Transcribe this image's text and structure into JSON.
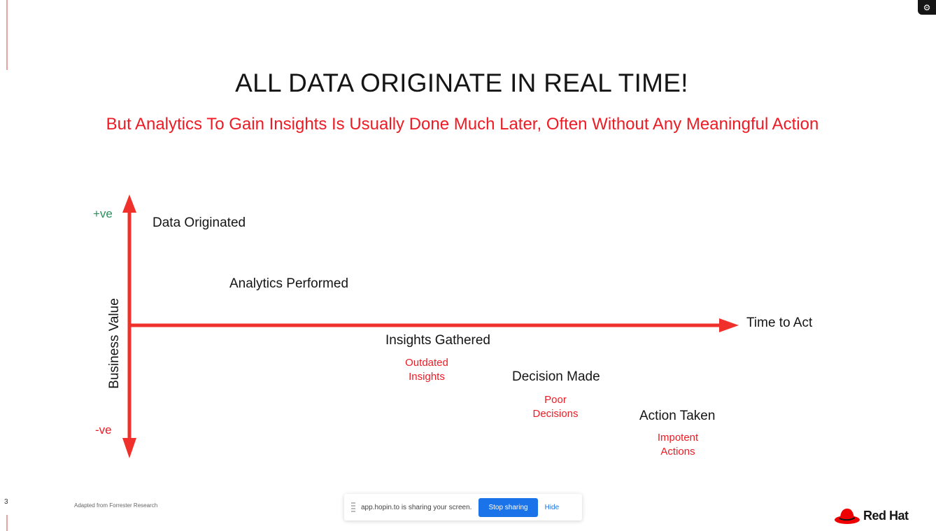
{
  "slide": {
    "title": "ALL DATA ORIGINATE IN REAL TIME!",
    "subtitle": "But Analytics To Gain Insights Is Usually Done Much Later, Often Without Any Meaningful Action",
    "y_axis": {
      "label": "Business Value",
      "positive": "+ve",
      "negative": "-ve"
    },
    "x_axis": {
      "label": "Time to Act"
    },
    "stages": [
      {
        "label": "Data Originated",
        "outcome": ""
      },
      {
        "label": "Analytics Performed",
        "outcome": ""
      },
      {
        "label": "Insights Gathered",
        "outcome_line1": "Outdated",
        "outcome_line2": "Insights"
      },
      {
        "label": "Decision Made",
        "outcome_line1": "Poor",
        "outcome_line2": "Decisions"
      },
      {
        "label": "Action Taken",
        "outcome_line1": "Impotent",
        "outcome_line2": "Actions"
      }
    ],
    "footer_note": "Adapted from Forrester Research",
    "page_number": "3"
  },
  "share_bar": {
    "message": "app.hopin.to is sharing your screen.",
    "stop_label": "Stop sharing",
    "hide_label": "Hide"
  },
  "brand": {
    "name": "Red Hat"
  },
  "colors": {
    "accent": "#ee1b24",
    "positive": "#2a8f5a",
    "arrow": "#f0302a",
    "button": "#1a73e8"
  }
}
